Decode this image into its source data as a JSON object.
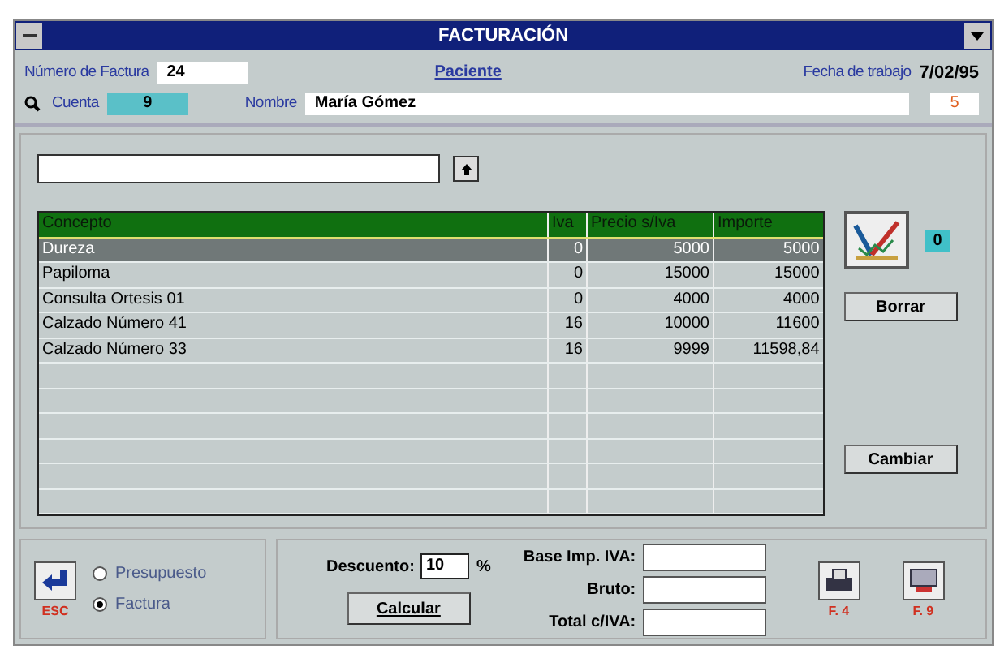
{
  "window": {
    "title": "FACTURACIÓN"
  },
  "header": {
    "invoice_label": "Número de Factura",
    "invoice_number": "24",
    "patient_title": "Paciente",
    "date_label": "Fecha de trabajo",
    "date": "7/02/95",
    "account_label": "Cuenta",
    "account": "9",
    "name_label": "Nombre",
    "name": "María Gómez",
    "counter": "5"
  },
  "table": {
    "columns": [
      "Concepto",
      "Iva",
      "Precio s/Iva",
      "Importe"
    ],
    "rows": [
      {
        "cells": [
          "Dureza",
          "0",
          "5000",
          "5000"
        ],
        "selected": true
      },
      {
        "cells": [
          "Papiloma",
          "0",
          "15000",
          "15000"
        ],
        "selected": false
      },
      {
        "cells": [
          "Consulta Ortesis 01",
          "0",
          "4000",
          "4000"
        ],
        "selected": false
      },
      {
        "cells": [
          "Calzado Número 41",
          "16",
          "10000",
          "11600"
        ],
        "selected": false
      },
      {
        "cells": [
          "Calzado Número 33",
          "16",
          "9999",
          "11598,84"
        ],
        "selected": false
      }
    ]
  },
  "side": {
    "badge": "0",
    "buttons": [
      "Borrar",
      "Cambiar"
    ]
  },
  "document_type": [
    {
      "label": "Presupuesto",
      "selected": false
    },
    {
      "label": "Factura",
      "selected": true
    }
  ],
  "esc_label": "ESC",
  "discount": {
    "label": "Descuento:",
    "value": "10",
    "unit": "%"
  },
  "calculate_button": "Calcular",
  "totals": [
    {
      "label": "Base Imp. IVA:"
    },
    {
      "label": "Bruto:"
    },
    {
      "label": "Total c/IVA:"
    }
  ],
  "function_keys": [
    "F. 4",
    "F. 9"
  ]
}
